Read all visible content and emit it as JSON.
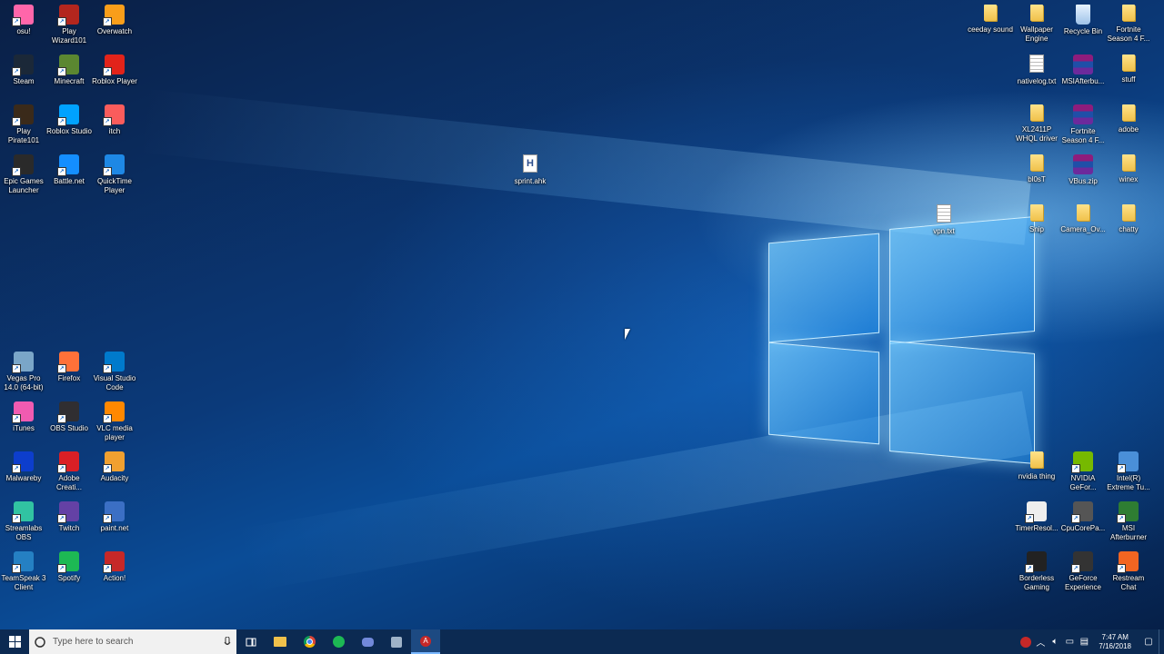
{
  "desktop": {
    "left_icons": [
      {
        "label": "osu!",
        "icon": "osu-icon",
        "color": "#ff66aa"
      },
      {
        "label": "Play Wizard101",
        "icon": "wizard101-icon",
        "color": "#b3261e"
      },
      {
        "label": "Overwatch",
        "icon": "overwatch-icon",
        "color": "#f99e1a"
      },
      {
        "label": "Steam",
        "icon": "steam-icon",
        "color": "#1b2838"
      },
      {
        "label": "Minecraft",
        "icon": "minecraft-icon",
        "color": "#5b8731"
      },
      {
        "label": "Roblox Player",
        "icon": "roblox-icon",
        "color": "#e2231a"
      },
      {
        "label": "Play Pirate101",
        "icon": "pirate101-icon",
        "color": "#3a2a1a"
      },
      {
        "label": "Roblox Studio",
        "icon": "roblox-studio-icon",
        "color": "#00a2ff"
      },
      {
        "label": "itch",
        "icon": "itch-icon",
        "color": "#fa5c5c"
      },
      {
        "label": "Epic Games Launcher",
        "icon": "epic-games-icon",
        "color": "#2a2a2a"
      },
      {
        "label": "Battle.net",
        "icon": "battlenet-icon",
        "color": "#148eff"
      },
      {
        "label": "QuickTime Player",
        "icon": "quicktime-icon",
        "color": "#1e88e5"
      },
      {
        "label": "Vegas Pro 14.0 (64-bit)",
        "icon": "vegas-pro-icon",
        "color": "#7aa6c8"
      },
      {
        "label": "Firefox",
        "icon": "firefox-icon",
        "color": "#ff7139"
      },
      {
        "label": "Visual Studio Code",
        "icon": "vscode-icon",
        "color": "#007acc"
      },
      {
        "label": "iTunes",
        "icon": "itunes-icon",
        "color": "#f05bb1"
      },
      {
        "label": "OBS Studio",
        "icon": "obs-icon",
        "color": "#302e31"
      },
      {
        "label": "VLC media player",
        "icon": "vlc-icon",
        "color": "#ff8800"
      },
      {
        "label": "Malwareby",
        "icon": "malwarebytes-icon",
        "color": "#0d3ecc"
      },
      {
        "label": "Adobe Creati...",
        "icon": "adobe-cc-icon",
        "color": "#da1f26"
      },
      {
        "label": "Audacity",
        "icon": "audacity-icon",
        "color": "#f0a030"
      },
      {
        "label": "Streamlabs OBS",
        "icon": "streamlabs-icon",
        "color": "#31c3a2"
      },
      {
        "label": "Twitch",
        "icon": "twitch-icon",
        "color": "#6441a5"
      },
      {
        "label": "paint.net",
        "icon": "paintnet-icon",
        "color": "#3b6fc4"
      },
      {
        "label": "TeamSpeak 3 Client",
        "icon": "teamspeak-icon",
        "color": "#2580c3"
      },
      {
        "label": "Spotify",
        "icon": "spotify-icon",
        "color": "#1db954"
      },
      {
        "label": "Action!",
        "icon": "action-icon",
        "color": "#c62828"
      }
    ],
    "middle_icons": [
      {
        "label": "sprint.ahk",
        "icon": "ahk-file-icon",
        "kind": "ahk"
      },
      {
        "label": "vpn.txt",
        "icon": "text-file-icon",
        "kind": "doc"
      }
    ],
    "right_icons": [
      {
        "label": "ceeday sound",
        "icon": "folder-icon",
        "kind": "folder"
      },
      {
        "label": "Wallpaper Engine",
        "icon": "folder-icon",
        "kind": "folder"
      },
      {
        "label": "Recycle Bin",
        "icon": "recycle-bin-icon",
        "kind": "bin"
      },
      {
        "label": "Fortnite Season 4 F...",
        "icon": "folder-icon",
        "kind": "folder"
      },
      {
        "label": "nativelog.txt",
        "icon": "text-file-icon",
        "kind": "doc"
      },
      {
        "label": "MSIAfterbu...",
        "icon": "winrar-icon",
        "kind": "rar"
      },
      {
        "label": "stuff",
        "icon": "folder-icon",
        "kind": "folder"
      },
      {
        "label": "XL2411P WHQL driver",
        "icon": "folder-icon",
        "kind": "folder"
      },
      {
        "label": "Fortnite Season 4 F...",
        "icon": "winrar-icon",
        "kind": "rar"
      },
      {
        "label": "adobe",
        "icon": "folder-icon",
        "kind": "folder"
      },
      {
        "label": "bl0sT",
        "icon": "folder-icon",
        "kind": "folder"
      },
      {
        "label": "VBus.zip",
        "icon": "winrar-icon",
        "kind": "rar"
      },
      {
        "label": "winex",
        "icon": "folder-icon",
        "kind": "folder"
      },
      {
        "label": "Snip",
        "icon": "folder-icon",
        "kind": "folder"
      },
      {
        "label": "Camera_Ov...",
        "icon": "folder-icon",
        "kind": "folder"
      },
      {
        "label": "chatty",
        "icon": "folder-icon",
        "kind": "folder"
      },
      {
        "label": "nvidia thing",
        "icon": "folder-icon",
        "kind": "folder"
      },
      {
        "label": "NVIDIA GeFor...",
        "icon": "nvidia-icon",
        "kind": "app",
        "color": "#76b900"
      },
      {
        "label": "Intel(R) Extreme Tu...",
        "icon": "intel-xtu-icon",
        "kind": "app",
        "color": "#4a8fd8"
      },
      {
        "label": "TimerResol...",
        "icon": "clock-icon",
        "kind": "app",
        "color": "#eeeeee"
      },
      {
        "label": "CpuCorePa...",
        "icon": "cpu-icon",
        "kind": "app",
        "color": "#555555"
      },
      {
        "label": "MSI Afterburner",
        "icon": "msi-afterburner-icon",
        "kind": "app",
        "color": "#2e7d32"
      },
      {
        "label": "Borderless Gaming",
        "icon": "borderless-gaming-icon",
        "kind": "app",
        "color": "#222222"
      },
      {
        "label": "GeForce Experience",
        "icon": "geforce-icon",
        "kind": "app",
        "color": "#333333"
      },
      {
        "label": "Restream Chat",
        "icon": "restream-icon",
        "kind": "app",
        "color": "#f26522"
      }
    ]
  },
  "taskbar": {
    "search_placeholder": "Type here to search",
    "time": "7:47 AM",
    "date": "7/16/2018",
    "colors": {
      "bar": "#0c2a52",
      "active": "#c62828"
    }
  }
}
